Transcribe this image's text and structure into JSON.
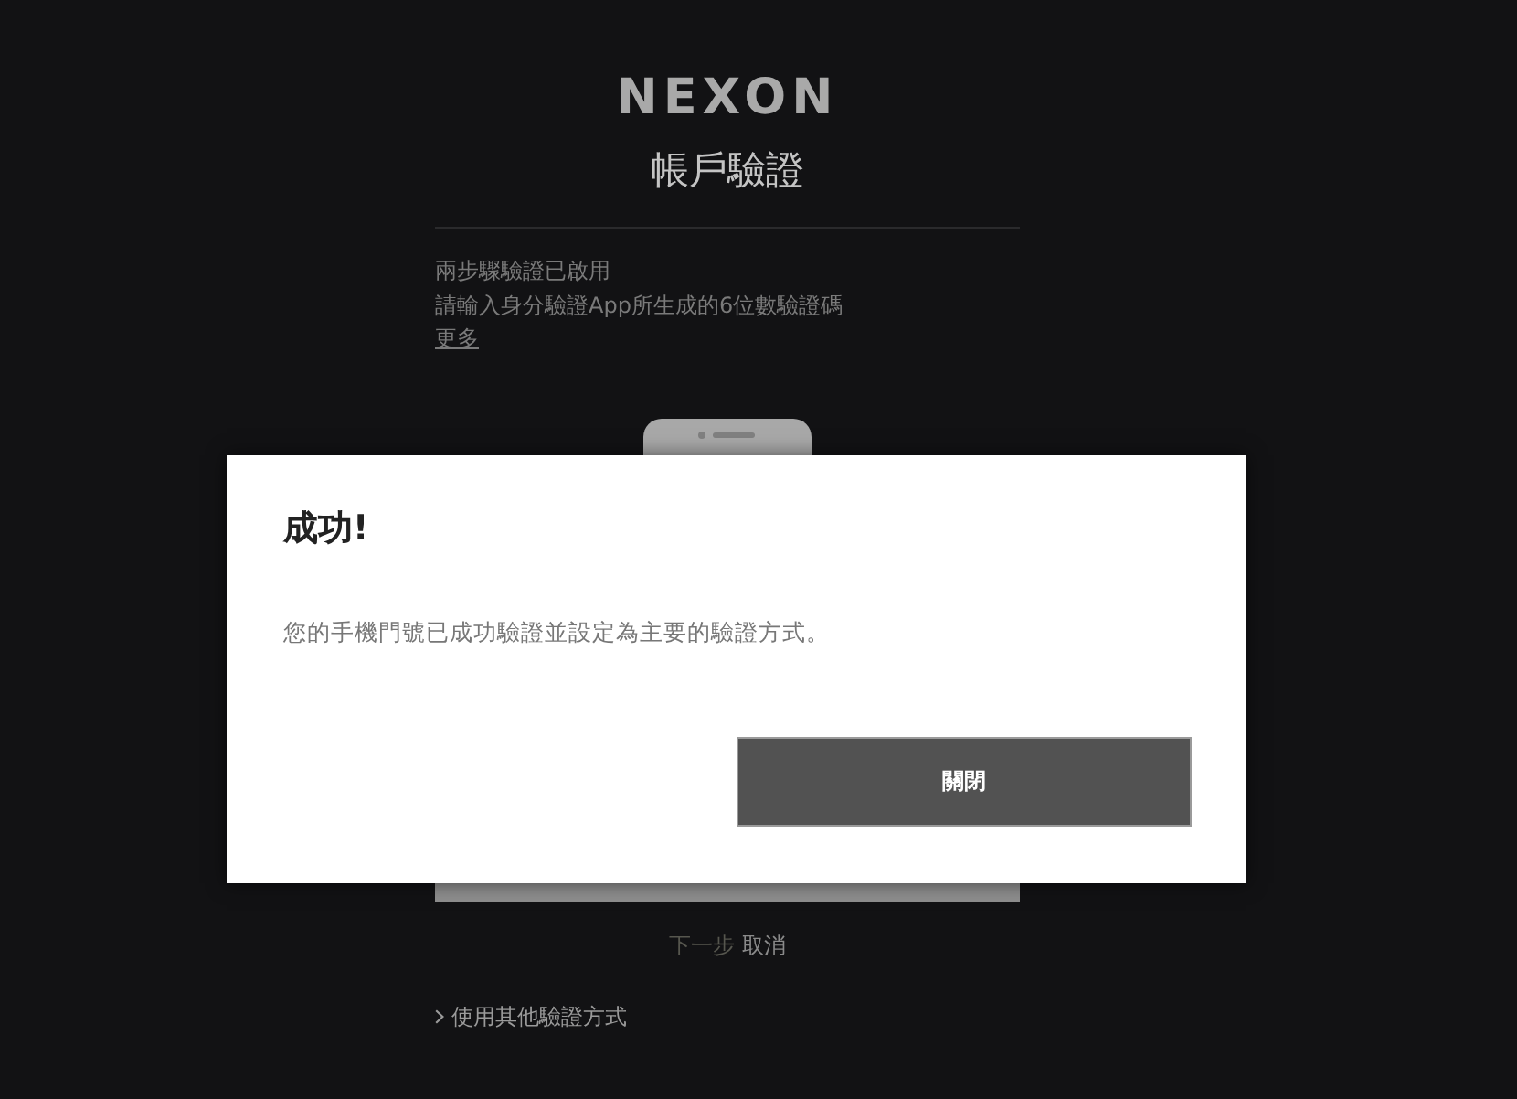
{
  "logo": {
    "text": "NEXON"
  },
  "page_title": "帳戶驗證",
  "info": {
    "lines": [
      "兩步驟驗證已啟用",
      "請輸入身分驗證App所生成的6位數驗證碼"
    ],
    "link": "更多"
  },
  "actions": [
    {
      "label": "下一步",
      "disabled": true
    },
    {
      "label": "取消",
      "disabled": false
    }
  ],
  "alternative_link": "使用其他驗證方式",
  "dialog": {
    "title": "成功!",
    "message": "您的手機門號已成功驗證並設定為主要的驗證方式。",
    "buttons": [
      "關閉"
    ]
  }
}
